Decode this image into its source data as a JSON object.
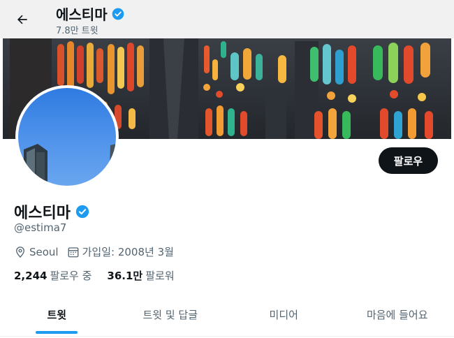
{
  "header": {
    "name": "에스티마",
    "tweet_count": "7.8만 트윗"
  },
  "profile": {
    "name": "에스티마",
    "handle": "@estima7",
    "location": "Seoul",
    "joined": "가입일: 2008년 3월",
    "following_count": "2,244",
    "following_label": "팔로우 중",
    "followers_count": "36.1만",
    "followers_label": "팔로워",
    "follow_button": "팔로우"
  },
  "tabs": [
    {
      "label": "트윗",
      "active": true
    },
    {
      "label": "트윗 및 답글",
      "active": false
    },
    {
      "label": "미디어",
      "active": false
    },
    {
      "label": "마음에 들어요",
      "active": false
    }
  ],
  "colors": {
    "verified": "#1d9bf0",
    "tab_indicator": "#1d9bf0",
    "follow_button_bg": "#0f1419"
  },
  "icons": [
    "back-arrow-icon",
    "verified-badge-icon",
    "location-pin-icon",
    "calendar-icon"
  ]
}
